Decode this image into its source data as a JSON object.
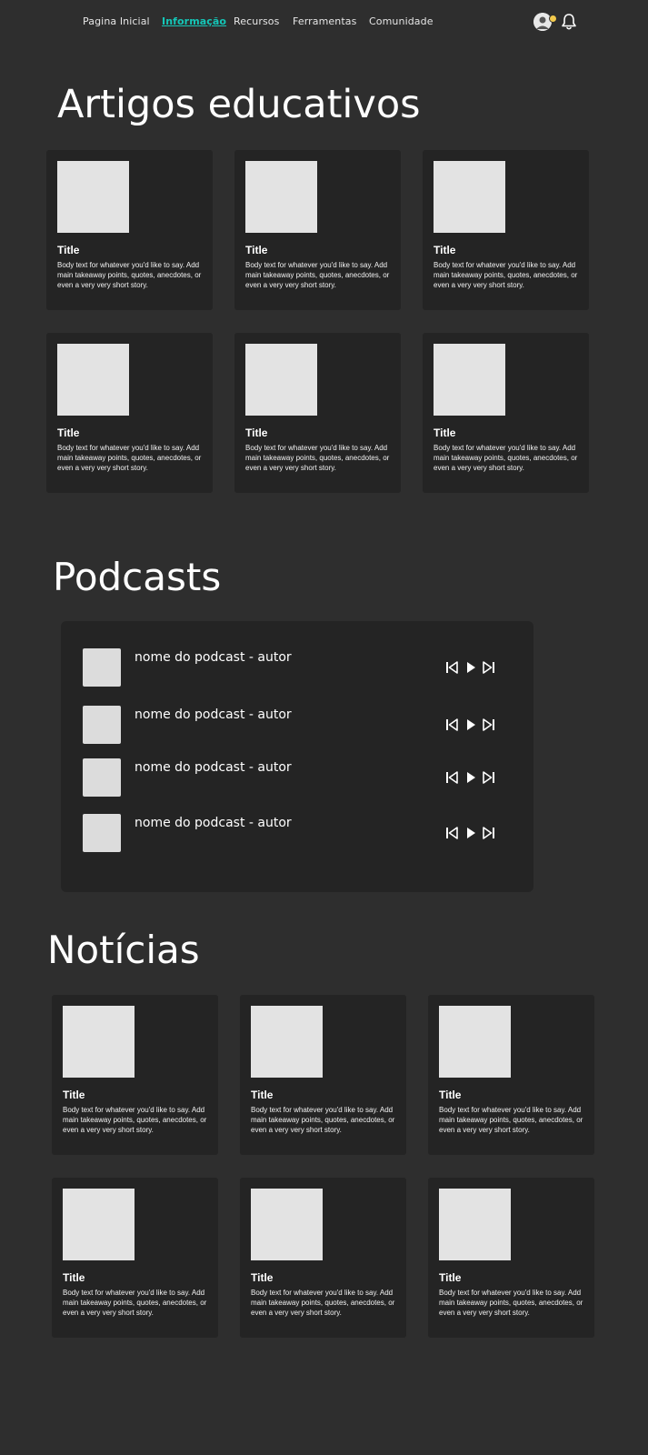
{
  "nav": {
    "links": [
      "Pagina Inicial",
      "Informação",
      "Recursos",
      "Ferramentas",
      "Comunidade"
    ],
    "active_index": 1,
    "active_color": "#14c7b8",
    "icons": {
      "avatar": "user-avatar",
      "notification": "bell-icon"
    }
  },
  "articles": {
    "title": "Artigos educativos",
    "cards": [
      {
        "title": "Title",
        "body": "Body text for whatever you'd like to say. Add main takeaway points, quotes, anecdotes, or even a very very short story."
      },
      {
        "title": "Title",
        "body": "Body text for whatever you'd like to say. Add main takeaway points, quotes, anecdotes, or even a very very short story."
      },
      {
        "title": "Title",
        "body": "Body text for whatever you'd like to say. Add main takeaway points, quotes, anecdotes, or even a very very short story."
      },
      {
        "title": "Title",
        "body": "Body text for whatever you'd like to say. Add main takeaway points, quotes, anecdotes, or even a very very short story."
      },
      {
        "title": "Title",
        "body": "Body text for whatever you'd like to say. Add main takeaway points, quotes, anecdotes, or even a very very short story."
      },
      {
        "title": "Title",
        "body": "Body text for whatever you'd like to say. Add main takeaway points, quotes, anecdotes, or even a very very short story."
      }
    ]
  },
  "podcasts": {
    "title": "Podcasts",
    "items": [
      {
        "name": "nome do podcast - autor"
      },
      {
        "name": "nome do podcast - autor"
      },
      {
        "name": "nome do podcast - autor"
      },
      {
        "name": "nome do podcast - autor"
      }
    ],
    "controls": [
      "skip-back-icon",
      "play-icon",
      "skip-forward-icon"
    ]
  },
  "news": {
    "title": "Notícias",
    "cards": [
      {
        "title": "Title",
        "body": "Body text for whatever you'd like to say. Add main takeaway points, quotes, anecdotes, or even a very very short story."
      },
      {
        "title": "Title",
        "body": "Body text for whatever you'd like to say. Add main takeaway points, quotes, anecdotes, or even a very very short story."
      },
      {
        "title": "Title",
        "body": "Body text for whatever you'd like to say. Add main takeaway points, quotes, anecdotes, or even a very very short story."
      },
      {
        "title": "Title",
        "body": "Body text for whatever you'd like to say. Add main takeaway points, quotes, anecdotes, or even a very very short story."
      },
      {
        "title": "Title",
        "body": "Body text for whatever you'd like to say. Add main takeaway points, quotes, anecdotes, or even a very very short story."
      },
      {
        "title": "Title",
        "body": "Body text for whatever you'd like to say. Add main takeaway points, quotes, anecdotes, or even a very very short story."
      }
    ]
  }
}
